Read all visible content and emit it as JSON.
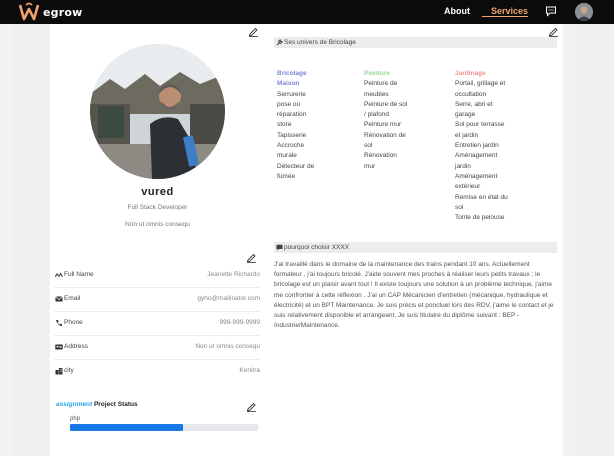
{
  "navbar": {
    "logo_text": "egrow",
    "about_label": "About",
    "services_label": "Services"
  },
  "profile": {
    "name": "vured",
    "title": "Full Stack Developer",
    "subtitle": "Non ut omnis consequ"
  },
  "info": [
    {
      "label": "Full Name",
      "value": "Jeanette Richardo",
      "icon": "signature-icon"
    },
    {
      "label": "Email",
      "value": "gyho@mailinator.com",
      "icon": "envelope-icon"
    },
    {
      "label": "Phone",
      "value": "999-999-9999",
      "icon": "phone-icon"
    },
    {
      "label": "Address",
      "value": "Non ut omnis consequ",
      "icon": "address-card-icon"
    },
    {
      "label": "city",
      "value": "Kenitra",
      "icon": "city-icon"
    }
  ],
  "project": {
    "accent": "assignment",
    "title": "Project Status",
    "item_label": "php",
    "progress": 0.6
  },
  "univers": {
    "heading": "Ses univers de Bricolage",
    "columns": [
      {
        "title": "Bricolage Maison",
        "color": "#7b87d6",
        "items": [
          "Serrurerie",
          "pose ou",
          "réparation",
          "store",
          "Tapisserie",
          "Accroche",
          "murale",
          "Détecteur de",
          "fumée"
        ]
      },
      {
        "title": "Peinture",
        "color": "#9ad69a",
        "items": [
          "Peinture de",
          "meubles",
          "Peinture de sol",
          "/ plafond",
          "Peinture mur",
          "Rénovation de",
          "sol",
          "Rénovation",
          "mur"
        ]
      },
      {
        "title": "Jardinage",
        "color": "#ef8f8f",
        "items": [
          "Portail, grillage et",
          "occultation",
          "Serre, abri et",
          "garage",
          "Sol pour terrasse",
          "et jardin",
          "Entretien jardin",
          "Aménagement",
          "jardin",
          "Aménagement",
          "extérieur",
          "Remise en état du",
          "sol",
          "Tonte de pelouse"
        ]
      }
    ]
  },
  "why": {
    "heading": "pourquoi choisir XXXX",
    "paragraph": "J'ai travaillé dans le domaine de la maintenance des trains pendant 10 ans. Actuellement formateur , j'ai toujours bricolé. J'aide souvent mes proches à réaliser leurs petits travaux ; le bricolage est un plaisir avant tout ! Il existe toujours une solution à un problème technique, j'aime me confronter à cette réflexion . J'ai un CAP Mécanicien d'entretien (mécanique, hydraulique et électricité) et un BPT Maintenance. Je suis précis et ponctuel lors des RDV, j'aime le contact et je suis relativement disponible et arrangeant. Je suis titulaire du diplôme suivant : BEP - Industrie/Maintenance."
  },
  "colors": {
    "navbar_bg": "#0b0b0b",
    "services_accent": "#f2a26e",
    "progress_fill": "#1977e6",
    "assignment_accent": "#2ba3e6"
  }
}
